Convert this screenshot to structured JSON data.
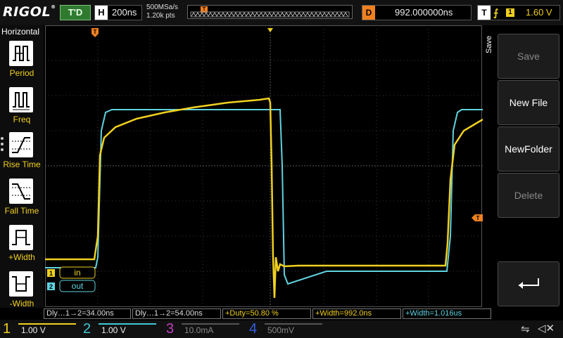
{
  "brand": "RIGOL",
  "header": {
    "run_status": "T'D",
    "timebase_tag": "H",
    "timebase": "200ns",
    "sample_rate": "500MSa/s",
    "mem_depth": "1.20k pts",
    "trigger_pos_tag": "T",
    "delay_tag": "D",
    "delay": "992.000000ns",
    "trigger_tag": "T",
    "trigger_edge": "rising-edge-icon",
    "trigger_source": "1",
    "trigger_level": "1.60 V"
  },
  "left_menu": {
    "title": "Horizontal",
    "items": [
      {
        "label": "Period",
        "icon": "period-icon"
      },
      {
        "label": "Freq",
        "icon": "frequency-icon"
      },
      {
        "label": "Rise Time",
        "icon": "rise-time-icon"
      },
      {
        "label": "Fall Time",
        "icon": "fall-time-icon"
      },
      {
        "label": "+Width",
        "icon": "positive-width-icon"
      },
      {
        "label": "-Width",
        "icon": "negative-width-icon"
      }
    ]
  },
  "right_menu": {
    "title": "Save",
    "buttons": [
      {
        "label": "Save",
        "enabled": false
      },
      {
        "label": "New File",
        "enabled": true
      },
      {
        "label": "NewFolder",
        "enabled": true
      },
      {
        "label": "Delete",
        "enabled": false
      }
    ],
    "enter_icon": "enter-icon"
  },
  "traces": [
    {
      "tag": "1",
      "label": "in",
      "color": "#f0d020"
    },
    {
      "tag": "2",
      "label": "out",
      "color": "#5fd3e0"
    }
  ],
  "trigger_level_marker": "T",
  "measurements": [
    {
      "text": "Dly…1→2=34.00ns"
    },
    {
      "text": "Dly…1→2=54.00ns"
    },
    {
      "text": "+Duty=50.80 %"
    },
    {
      "text": "+Width=992.0ns"
    },
    {
      "text": "+Width=1.016us"
    }
  ],
  "channels": [
    {
      "num": "1",
      "value": "1.00 V",
      "color": "#f0d020"
    },
    {
      "num": "2",
      "value": "1.00 V",
      "color": "#3ec8d8"
    },
    {
      "num": "3",
      "value": "10.0mA",
      "color": "#c040c0"
    },
    {
      "num": "4",
      "value": "500mV",
      "color": "#3060e0"
    }
  ],
  "status_icons": [
    "usb-icon",
    "speaker-muted-icon"
  ]
}
